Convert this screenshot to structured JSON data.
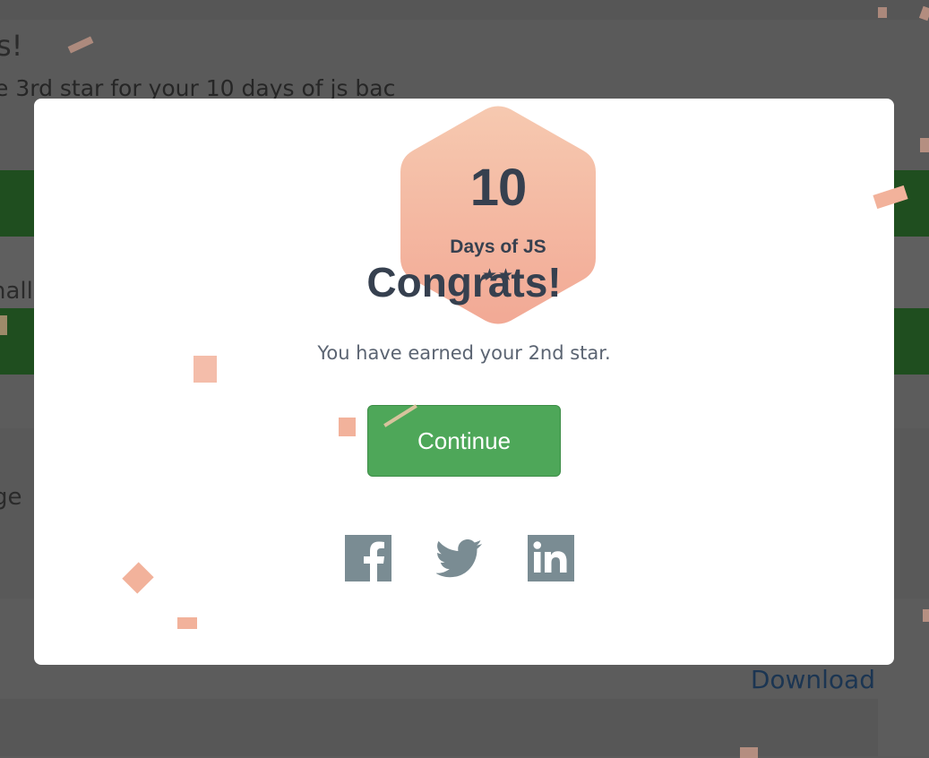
{
  "background": {
    "heading": "s!",
    "subtitle": "e 3rd star for your 10 days of js bac",
    "challenge_text": "halle",
    "page_text": "ge",
    "download_link": "Download"
  },
  "modal": {
    "badge": {
      "number": "10",
      "label": "Days of JS",
      "stars": "★★"
    },
    "title": "Congrats!",
    "message": "You have earned your 2nd star.",
    "continue_label": "Continue",
    "share_icons": [
      "facebook-icon",
      "twitter-icon",
      "linkedin-icon"
    ]
  },
  "colors": {
    "accent_green": "#4ea759",
    "badge_gradient_top": "#f6c6ad",
    "badge_gradient_bottom": "#f2ab96",
    "text_dark": "#36404f",
    "social_icon": "#7a8c93",
    "overlay": "#5c5c5c"
  }
}
